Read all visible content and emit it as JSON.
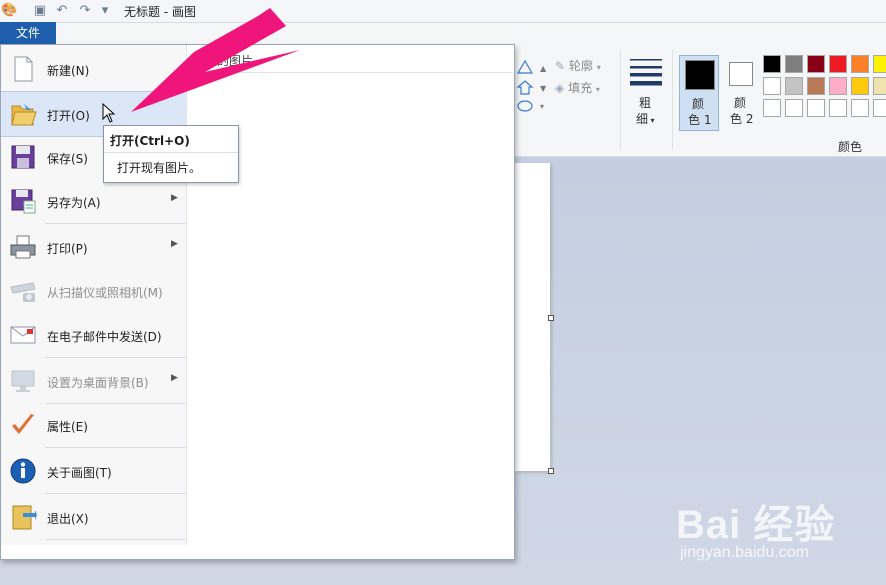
{
  "window": {
    "title": "无标题 - 画图"
  },
  "file_tab": {
    "label": "文件"
  },
  "file_menu": {
    "items": [
      {
        "label": "新建(N)",
        "icon": "new-file-icon",
        "enabled": true,
        "submenu": false
      },
      {
        "label": "打开(O)",
        "icon": "open-folder-icon",
        "enabled": true,
        "submenu": false,
        "selected": true
      },
      {
        "label": "保存(S)",
        "icon": "save-icon",
        "enabled": true,
        "submenu": false
      },
      {
        "label": "另存为(A)",
        "icon": "save-as-icon",
        "enabled": true,
        "submenu": true
      },
      {
        "label": "打印(P)",
        "icon": "printer-icon",
        "enabled": true,
        "submenu": true
      },
      {
        "label": "从扫描仪或照相机(M)",
        "icon": "scanner-camera-icon",
        "enabled": false,
        "submenu": false
      },
      {
        "label": "在电子邮件中发送(D)",
        "icon": "email-icon",
        "enabled": true,
        "submenu": false
      },
      {
        "label": "设置为桌面背景(B)",
        "icon": "desktop-background-icon",
        "enabled": false,
        "submenu": true
      },
      {
        "label": "属性(E)",
        "icon": "checkmark-icon",
        "enabled": true,
        "submenu": false
      },
      {
        "label": "关于画图(T)",
        "icon": "info-icon",
        "enabled": true,
        "submenu": false
      },
      {
        "label": "退出(X)",
        "icon": "exit-icon",
        "enabled": true,
        "submenu": false
      }
    ],
    "recent_header": "最近的图片"
  },
  "tooltip": {
    "title": "打开(Ctrl+O)",
    "description": "打开现有图片。"
  },
  "ribbon": {
    "outline_label": "轮廓",
    "fill_label": "填充",
    "size_label_1": "粗",
    "size_label_2": "细",
    "color1_label_1": "颜",
    "color1_label_2": "色 1",
    "color2_label_1": "颜",
    "color2_label_2": "色 2",
    "colors_group_label": "颜色",
    "color1": "#000000",
    "color2": "#ffffff",
    "palette_row1": [
      "#000000",
      "#7f7f7f",
      "#880015",
      "#ed1c24",
      "#ff7f27",
      "#fff200"
    ],
    "palette_row2": [
      "#ffffff",
      "#c3c3c3",
      "#b97a57",
      "#ffaec9",
      "#ffc90e",
      "#efe4b0"
    ],
    "palette_row3": [
      "#ffffff",
      "#ffffff",
      "#ffffff",
      "#ffffff",
      "#ffffff",
      "#ffffff"
    ]
  },
  "watermark": {
    "brand": "Bai 经验",
    "url": "jingyan.baidu.com"
  },
  "annotation": {
    "arrow_color": "#f0157a"
  }
}
